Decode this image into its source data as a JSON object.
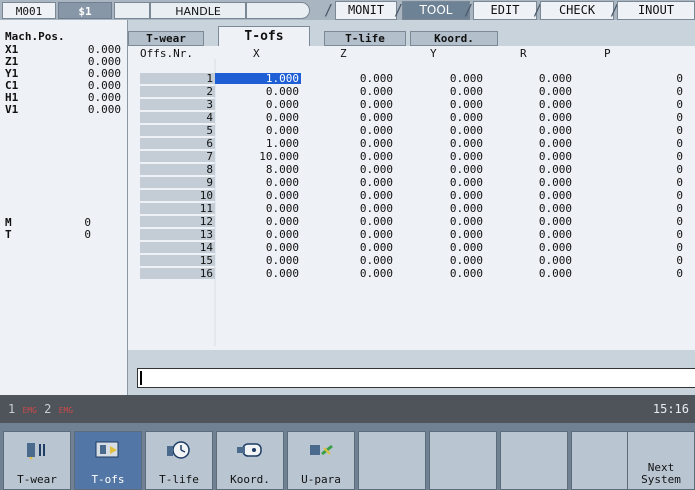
{
  "top_bar": {
    "machine": "M001",
    "system": "$1",
    "mode": "HANDLE",
    "menu": [
      "MONIT",
      "TOOL",
      "EDIT",
      "CHECK",
      "INOUT"
    ],
    "active_menu": "TOOL"
  },
  "sub_tabs": [
    "T-wear",
    "T-ofs",
    "T-life",
    "Koord."
  ],
  "active_sub_tab": "T-ofs",
  "machine_position": {
    "title": "Mach.Pos.",
    "axes": [
      {
        "name": "X1",
        "value": "0.000"
      },
      {
        "name": "Z1",
        "value": "0.000"
      },
      {
        "name": "Y1",
        "value": "0.000"
      },
      {
        "name": "C1",
        "value": "0.000"
      },
      {
        "name": "H1",
        "value": "0.000"
      },
      {
        "name": "V1",
        "value": "0.000"
      }
    ],
    "mt": [
      {
        "name": "M",
        "value": "0"
      },
      {
        "name": "T",
        "value": "0"
      }
    ]
  },
  "table": {
    "headers": [
      "Offs.Nr.",
      "X",
      "Z",
      "Y",
      "R",
      "P"
    ],
    "rows": [
      [
        "1",
        "1.000",
        "0.000",
        "0.000",
        "0.000",
        "0"
      ],
      [
        "2",
        "0.000",
        "0.000",
        "0.000",
        "0.000",
        "0"
      ],
      [
        "3",
        "0.000",
        "0.000",
        "0.000",
        "0.000",
        "0"
      ],
      [
        "4",
        "0.000",
        "0.000",
        "0.000",
        "0.000",
        "0"
      ],
      [
        "5",
        "0.000",
        "0.000",
        "0.000",
        "0.000",
        "0"
      ],
      [
        "6",
        "1.000",
        "0.000",
        "0.000",
        "0.000",
        "0"
      ],
      [
        "7",
        "10.000",
        "0.000",
        "0.000",
        "0.000",
        "0"
      ],
      [
        "8",
        "8.000",
        "0.000",
        "0.000",
        "0.000",
        "0"
      ],
      [
        "9",
        "0.000",
        "0.000",
        "0.000",
        "0.000",
        "0"
      ],
      [
        "10",
        "0.000",
        "0.000",
        "0.000",
        "0.000",
        "0"
      ],
      [
        "11",
        "0.000",
        "0.000",
        "0.000",
        "0.000",
        "0"
      ],
      [
        "12",
        "0.000",
        "0.000",
        "0.000",
        "0.000",
        "0"
      ],
      [
        "13",
        "0.000",
        "0.000",
        "0.000",
        "0.000",
        "0"
      ],
      [
        "14",
        "0.000",
        "0.000",
        "0.000",
        "0.000",
        "0"
      ],
      [
        "15",
        "0.000",
        "0.000",
        "0.000",
        "0.000",
        "0"
      ],
      [
        "16",
        "0.000",
        "0.000",
        "0.000",
        "0.000",
        "0"
      ]
    ],
    "selected_row": 0
  },
  "input_line": "",
  "status": {
    "alarm_1": "1",
    "alarm_1_tag": "EMG",
    "alarm_2": "2",
    "alarm_2_tag": "EMG",
    "clock": "15:16"
  },
  "softkeys": [
    {
      "label": "T-wear",
      "icon": "tool-wear-icon"
    },
    {
      "label": "T-ofs",
      "icon": "tool-offset-icon"
    },
    {
      "label": "T-life",
      "icon": "tool-life-icon"
    },
    {
      "label": "Koord.",
      "icon": "coordinate-icon"
    },
    {
      "label": "U-para",
      "icon": "user-param-icon"
    },
    {
      "label": "",
      "icon": ""
    },
    {
      "label": "",
      "icon": ""
    },
    {
      "label": "",
      "icon": ""
    },
    {
      "label": "",
      "icon": ""
    },
    {
      "label": "Next System",
      "line1": "Next",
      "line2": "System",
      "icon": ""
    }
  ],
  "colors": {
    "selection": "#1f5fd6",
    "active_tab": "#6e8296",
    "active_softkey": "#5276a6",
    "alarm_red": "#c84a4a"
  }
}
